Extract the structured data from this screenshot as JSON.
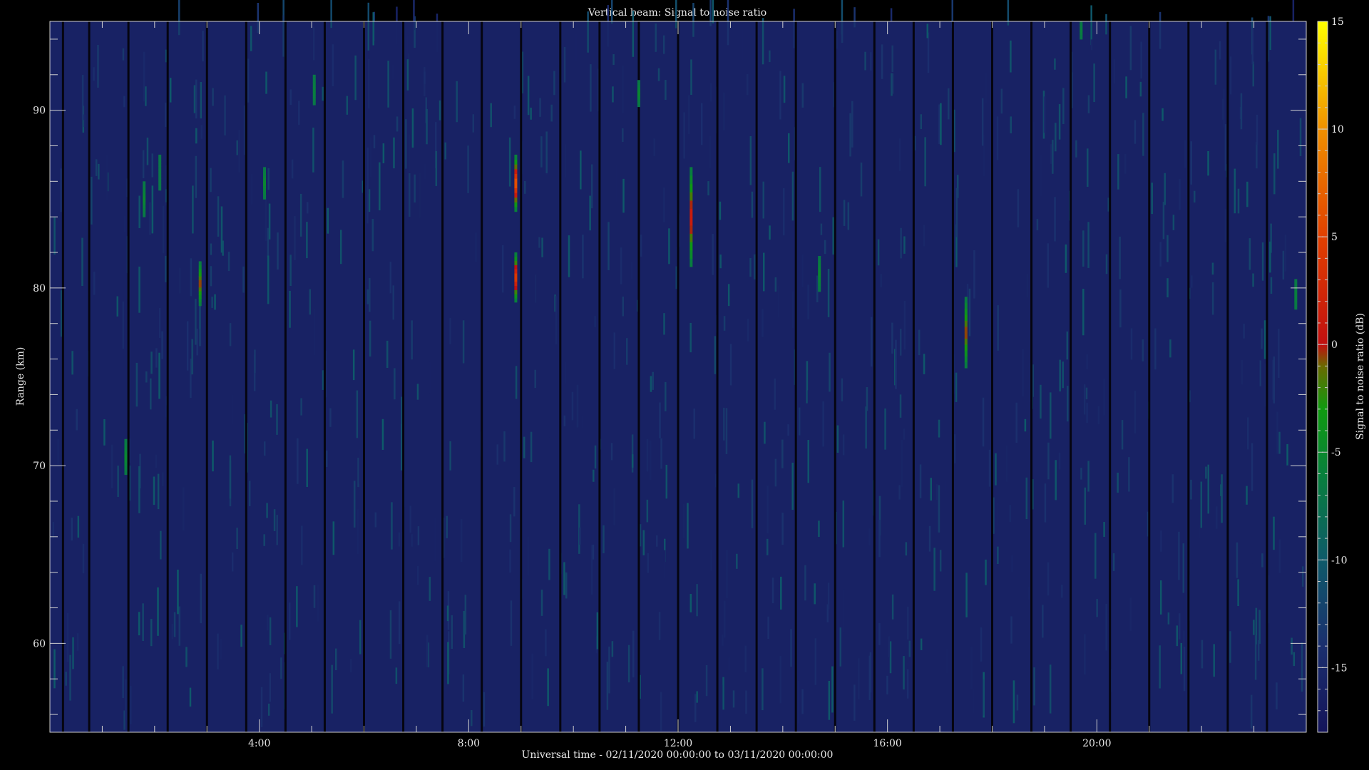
{
  "chart_data": {
    "type": "heatmap",
    "title": "Vertical beam: Signal to noise ratio",
    "xlabel": "Universal time - 02/11/2020 00:00:00 to 03/11/2020 00:00:00",
    "ylabel": "Range (km)",
    "colorbar_label": "Signal to noise ratio (dB)",
    "xlim_hours": [
      0,
      24
    ],
    "ylim_km": [
      55,
      95
    ],
    "x_ticks": [
      {
        "value": 4,
        "label": "4:00"
      },
      {
        "value": 8,
        "label": "8:00"
      },
      {
        "value": 12,
        "label": "12:00"
      },
      {
        "value": 16,
        "label": "16:00"
      },
      {
        "value": 20,
        "label": "20:00"
      }
    ],
    "y_ticks": [
      {
        "value": 60,
        "label": "60"
      },
      {
        "value": 70,
        "label": "70"
      },
      {
        "value": 80,
        "label": "80"
      },
      {
        "value": 90,
        "label": "90"
      }
    ],
    "colorbar_range_db": [
      -18,
      15
    ],
    "colorbar_ticks": [
      {
        "value": 15,
        "label": "15"
      },
      {
        "value": 10,
        "label": "10"
      },
      {
        "value": 5,
        "label": "5"
      },
      {
        "value": 0,
        "label": "0"
      },
      {
        "value": -5,
        "label": "-5"
      },
      {
        "value": -10,
        "label": "-10"
      },
      {
        "value": -15,
        "label": "-15"
      }
    ],
    "colormap": [
      {
        "db": -18,
        "color": "#14145a"
      },
      {
        "db": -14,
        "color": "#1b2f6e"
      },
      {
        "db": -10,
        "color": "#0e5a6a"
      },
      {
        "db": -6,
        "color": "#08803c"
      },
      {
        "db": -3,
        "color": "#109a10"
      },
      {
        "db": -1,
        "color": "#6a6a00"
      },
      {
        "db": 0,
        "color": "#c01010"
      },
      {
        "db": 5,
        "color": "#e04000"
      },
      {
        "db": 10,
        "color": "#f09000"
      },
      {
        "db": 15,
        "color": "#ffff00"
      }
    ],
    "background_level_db": -16,
    "data_gaps_hours": [
      0.25,
      0.75,
      1.5,
      2.25,
      3.0,
      3.75,
      4.5,
      5.25,
      6.0,
      6.75,
      7.5,
      8.25,
      9.0,
      9.75,
      10.5,
      11.25,
      12.0,
      12.75,
      13.5,
      14.25,
      15.0,
      15.75,
      16.5,
      17.25,
      18.0,
      18.75,
      19.5,
      20.25,
      21.0,
      21.75,
      22.5,
      23.25
    ],
    "echoes": [
      {
        "time_h": 1.45,
        "range_km": [
          69.5,
          71.5
        ],
        "peak_db": -5
      },
      {
        "time_h": 1.8,
        "range_km": [
          84,
          86
        ],
        "peak_db": -5
      },
      {
        "time_h": 2.1,
        "range_km": [
          85.5,
          87.5
        ],
        "peak_db": -7
      },
      {
        "time_h": 2.87,
        "range_km": [
          79,
          81.5
        ],
        "peak_db": 0
      },
      {
        "time_h": 4.1,
        "range_km": [
          85,
          86.8
        ],
        "peak_db": -5
      },
      {
        "time_h": 5.05,
        "range_km": [
          90.3,
          92
        ],
        "peak_db": -6
      },
      {
        "time_h": 8.9,
        "range_km": [
          84.3,
          87.5
        ],
        "peak_db": 7
      },
      {
        "time_h": 8.9,
        "range_km": [
          79.2,
          82
        ],
        "peak_db": 5
      },
      {
        "time_h": 11.25,
        "range_km": [
          90.2,
          91.7
        ],
        "peak_db": -5
      },
      {
        "time_h": 12.25,
        "range_km": [
          81.2,
          86.8
        ],
        "peak_db": 2
      },
      {
        "time_h": 14.7,
        "range_km": [
          79.8,
          81.8
        ],
        "peak_db": -5
      },
      {
        "time_h": 17.5,
        "range_km": [
          75.5,
          79.5
        ],
        "peak_db": 0
      },
      {
        "time_h": 19.7,
        "range_km": [
          94,
          95
        ],
        "peak_db": -6
      },
      {
        "time_h": 23.8,
        "range_km": [
          78.8,
          80.5
        ],
        "peak_db": -6
      }
    ]
  }
}
